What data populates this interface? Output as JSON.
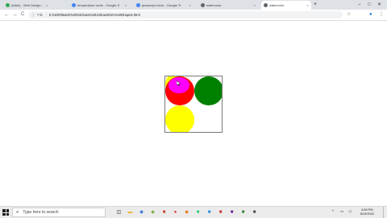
{
  "browser": {
    "tabs": [
      {
        "title": "(Main) - Web Design and D",
        "favicon_color": "#34a853",
        "close": "×"
      },
      {
        "title": "temperature circle - Google S",
        "favicon_color": "#4285f4",
        "close": "×"
      },
      {
        "title": "javascript circle - Google Tr",
        "favicon_color": "#4285f4",
        "close": "×"
      },
      {
        "title": "watercolor",
        "favicon_color": "#5f6368",
        "close": "×"
      },
      {
        "title": "watercolor",
        "favicon_color": "#5f6368",
        "close": "×"
      }
    ],
    "new_tab": "+",
    "window_controls": {
      "minimize": "–",
      "maximize": "□",
      "close": "✕"
    },
    "nav": {
      "back": "←",
      "forward": "→",
      "reload": "C"
    },
    "address": {
      "info_icon": "ⓘ",
      "scheme_label": "File",
      "url": "E:/UDR/Batch%2004/class%2012/transform%20shapes.html"
    },
    "toolbar_icons": {
      "star": "☆",
      "profile": "●",
      "menu": "⋮"
    }
  },
  "canvas": {
    "circles": [
      {
        "name": "yellow-circle-top-left",
        "color": "#ffff00"
      },
      {
        "name": "red-circle",
        "color": "#ff0000"
      },
      {
        "name": "green-circle",
        "color": "#008000"
      },
      {
        "name": "yellow-circle-bottom",
        "color": "#ffff00"
      },
      {
        "name": "magenta-circle",
        "color": "#ff00ff"
      }
    ]
  },
  "taskbar": {
    "search_placeholder": "Type here to search",
    "apps": [
      {
        "icon": "task-view-icon",
        "glyph": "◫",
        "color": "#222222"
      },
      {
        "icon": "file-explorer-icon",
        "glyph": "▬",
        "color": "#e8b830"
      },
      {
        "icon": "app-icon",
        "glyph": "◆",
        "color": "#3b78d8"
      },
      {
        "icon": "app-icon",
        "glyph": "◆",
        "color": "#7fb04a"
      },
      {
        "icon": "app-icon",
        "glyph": "■",
        "color": "#c0392b"
      },
      {
        "icon": "chrome-icon",
        "glyph": "●",
        "color": "#d93025"
      },
      {
        "icon": "app-icon",
        "glyph": "◆",
        "color": "#e67e22"
      },
      {
        "icon": "app-icon",
        "glyph": "■",
        "color": "#2ecc71"
      },
      {
        "icon": "app-icon",
        "glyph": "■",
        "color": "#1e88e5"
      },
      {
        "icon": "app-icon",
        "glyph": "■",
        "color": "#c62828"
      },
      {
        "icon": "app-icon",
        "glyph": "■",
        "color": "#6a1b9a"
      },
      {
        "icon": "app-icon",
        "glyph": "■",
        "color": "#2e7d32"
      },
      {
        "icon": "app-icon",
        "glyph": "■",
        "color": "#424242"
      }
    ],
    "tray": {
      "chevron": "^",
      "network": "▭",
      "volume": "◁"
    },
    "time": "8:59 PM",
    "date": "8/19/2020"
  }
}
